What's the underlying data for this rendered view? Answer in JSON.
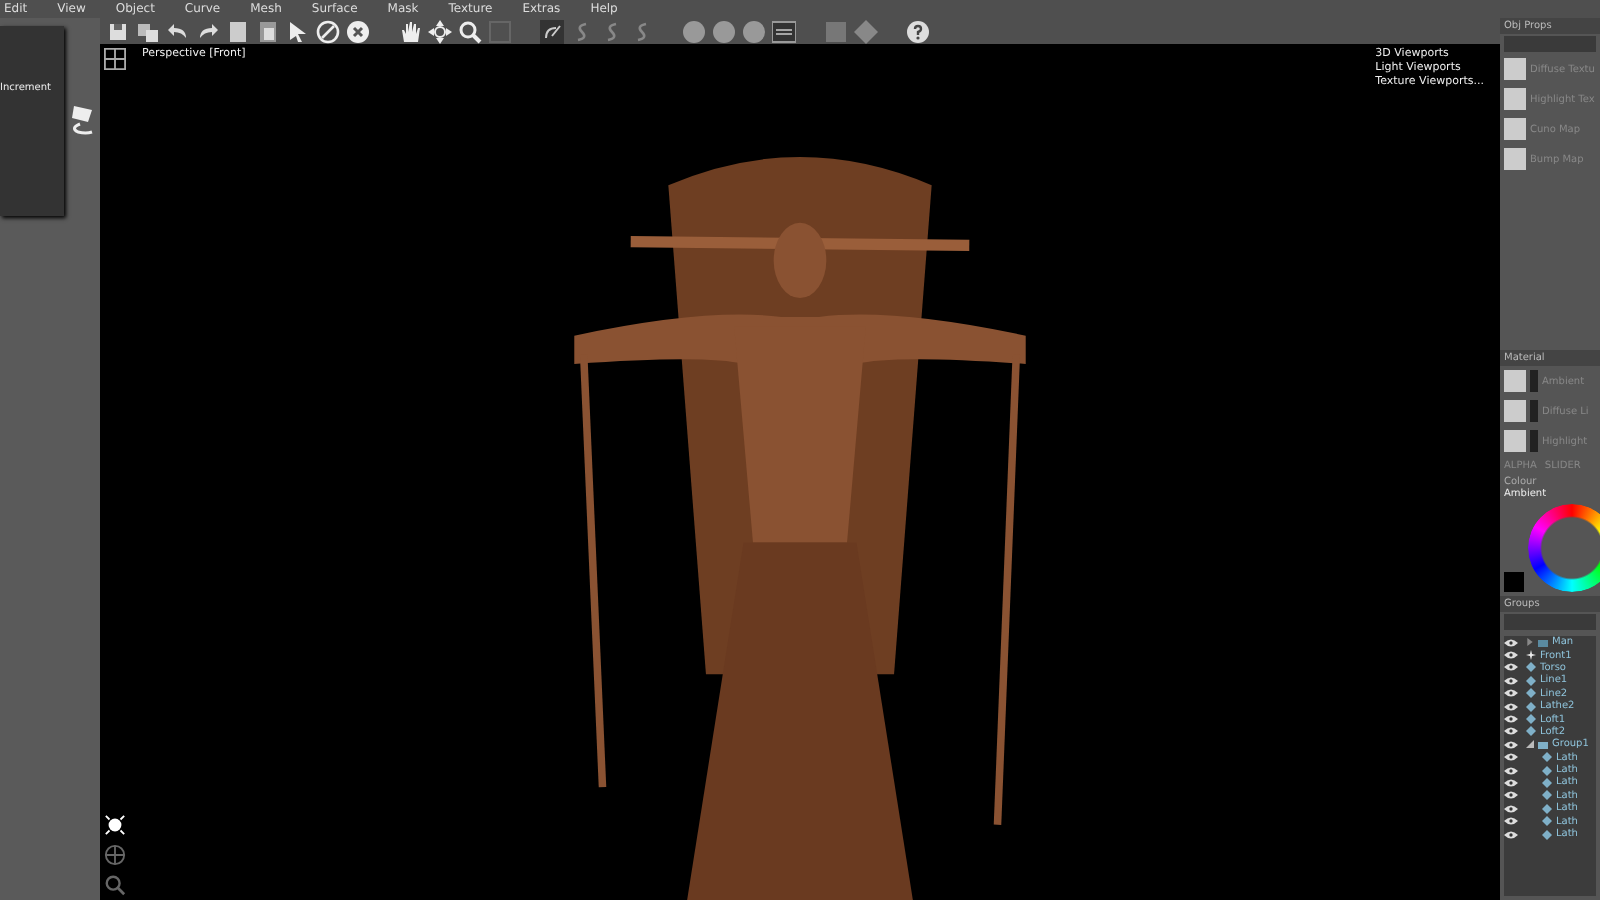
{
  "menu": [
    "Edit",
    "View",
    "Object",
    "Curve",
    "Mesh",
    "Surface",
    "Mask",
    "Texture",
    "Extras",
    "Help"
  ],
  "left_panel": {
    "popup_label": "Increment"
  },
  "viewport": {
    "label": "Perspective [Front]",
    "menu": [
      "3D Viewports",
      "Light Viewports",
      "Texture Viewports..."
    ]
  },
  "obj_props": {
    "title": "Obj Props",
    "textures": [
      "Diffuse Textu",
      "Highlight Tex",
      "Cuno Map",
      "Bump Map"
    ]
  },
  "material": {
    "title": "Material",
    "slots": [
      "Ambient",
      "Diffuse Li",
      "Highlight"
    ],
    "alpha": "ALPHA",
    "slider": "SLIDER"
  },
  "colour": {
    "title": "Colour",
    "channel": "Ambient"
  },
  "groups": {
    "title": "Groups",
    "items": [
      {
        "name": "Man",
        "kind": "group",
        "expanded": false
      },
      {
        "name": "Front1",
        "kind": "light"
      },
      {
        "name": "Torso",
        "kind": "mesh"
      },
      {
        "name": "Line1",
        "kind": "mesh"
      },
      {
        "name": "Line2",
        "kind": "mesh"
      },
      {
        "name": "Lathe2",
        "kind": "mesh"
      },
      {
        "name": "Loft1",
        "kind": "mesh"
      },
      {
        "name": "Loft2",
        "kind": "mesh"
      },
      {
        "name": "Group1",
        "kind": "group",
        "expanded": true,
        "children": [
          {
            "name": "Lath",
            "kind": "mesh"
          },
          {
            "name": "Lath",
            "kind": "mesh"
          },
          {
            "name": "Lath",
            "kind": "mesh"
          },
          {
            "name": "Lath",
            "kind": "mesh"
          },
          {
            "name": "Lath",
            "kind": "mesh"
          },
          {
            "name": "Lath",
            "kind": "mesh"
          },
          {
            "name": "Lath",
            "kind": "mesh"
          }
        ]
      }
    ]
  }
}
